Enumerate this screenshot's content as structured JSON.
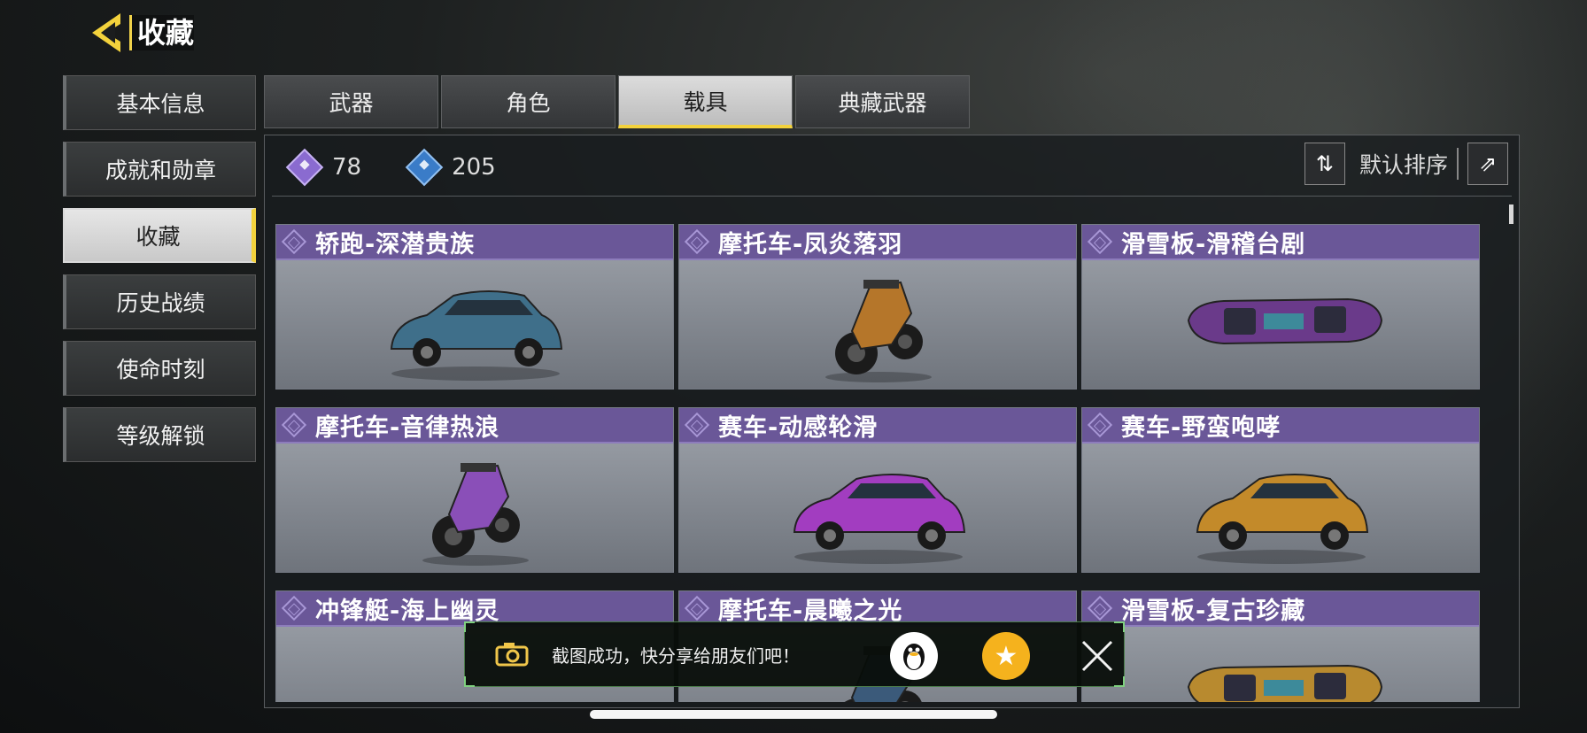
{
  "header": {
    "title": "收藏"
  },
  "nav": {
    "items": [
      {
        "label": "基本信息",
        "active": false
      },
      {
        "label": "成就和勋章",
        "active": false
      },
      {
        "label": "收藏",
        "active": true
      },
      {
        "label": "历史战绩",
        "active": false
      },
      {
        "label": "使命时刻",
        "active": false
      },
      {
        "label": "等级解锁",
        "active": false
      }
    ]
  },
  "tabs": [
    {
      "label": "武器",
      "active": false
    },
    {
      "label": "角色",
      "active": false
    },
    {
      "label": "载具",
      "active": true
    },
    {
      "label": "典藏武器",
      "active": false
    }
  ],
  "stats": [
    {
      "icon": "purple-gem-icon",
      "value": "78",
      "color": "#8a6bd0"
    },
    {
      "icon": "blue-gem-icon",
      "value": "205",
      "color": "#3a7cc8"
    }
  ],
  "sort": {
    "label": "默认排序"
  },
  "items": [
    {
      "name": "轿跑-深潜贵族",
      "kind": "car",
      "color": "#3f6f8a"
    },
    {
      "name": "摩托车-凤炎落羽",
      "kind": "bike",
      "color": "#b5762a"
    },
    {
      "name": "滑雪板-滑稽台剧",
      "kind": "board",
      "color": "#6a3a8a"
    },
    {
      "name": "摩托车-音律热浪",
      "kind": "bike",
      "color": "#8a4fb8"
    },
    {
      "name": "赛车-动感轮滑",
      "kind": "car",
      "color": "#a23dc0"
    },
    {
      "name": "赛车-野蛮咆哮",
      "kind": "car",
      "color": "#c38a2a"
    },
    {
      "name": "冲锋艇-海上幽灵",
      "kind": "boat",
      "color": "#2c5e9e"
    },
    {
      "name": "摩托车-晨曦之光",
      "kind": "bike",
      "color": "#3b5a7a"
    },
    {
      "name": "滑雪板-复古珍藏",
      "kind": "board",
      "color": "#b88a2f"
    }
  ],
  "toast": {
    "message": "截图成功，快分享给朋友们吧！"
  }
}
